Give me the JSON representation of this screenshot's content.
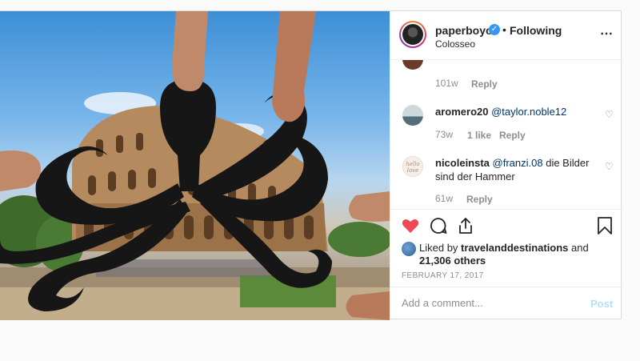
{
  "header": {
    "username": "paperboyo",
    "verified_icon": "verified-badge-icon",
    "dot": "•",
    "following": "Following",
    "location": "Colosseo",
    "more_icon": "⋯"
  },
  "comments": [
    {
      "meta_time": "101w",
      "reply": "Reply"
    },
    {
      "user": "aromero20",
      "mention": "@taylor.noble12",
      "text": "",
      "time": "73w",
      "likes": "1 like",
      "reply": "Reply"
    },
    {
      "user": "nicoleinsta",
      "mention": "@franzi.08",
      "text": " die Bilder sind der Hammer",
      "time": "61w",
      "reply": "Reply",
      "avatar_text": "hello love"
    }
  ],
  "actions": {
    "like_icon": "heart-icon",
    "comment_icon": "comment-icon",
    "share_icon": "share-icon",
    "save_icon": "bookmark-icon",
    "liked_prefix": "Liked by ",
    "liked_user": "travelanddestinations",
    "liked_suffix": " and",
    "liked_others": "21,306 others",
    "date": "FEBRUARY 17, 2017"
  },
  "add_comment": {
    "placeholder": "Add a comment...",
    "post": "Post"
  },
  "colors": {
    "like_red": "#ed4956",
    "verified_blue": "#3897f0",
    "post_disabled": "#b2dffc"
  }
}
